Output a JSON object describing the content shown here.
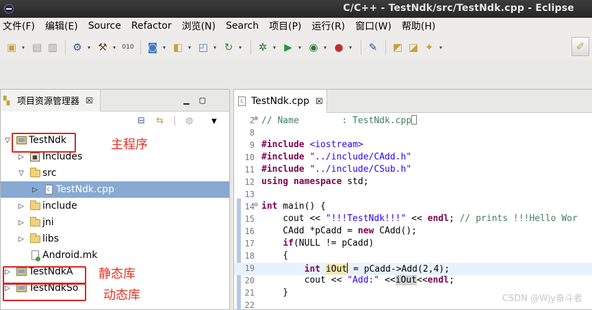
{
  "window": {
    "title": "C/C++ - TestNdk/src/TestNdk.cpp - Eclipse"
  },
  "menu": [
    "文件(F)",
    "编辑(E)",
    "Source",
    "Refactor",
    "浏览(N)",
    "Search",
    "项目(P)",
    "运行(R)",
    "窗口(W)",
    "帮助(H)"
  ],
  "toolbar": {
    "icons": [
      "new-icon",
      "save-icon",
      "save-all-icon",
      "settings-icon",
      "build-icon",
      "binary-icon",
      "new-class-icon",
      "new-folder-icon",
      "new-file-icon",
      "refresh-icon",
      "debug-icon",
      "run-icon",
      "external-tools-icon",
      "profile-icon",
      "pin-icon",
      "open-type-icon",
      "open-element-icon",
      "search-icon",
      "perspective-icon"
    ]
  },
  "explorer": {
    "tab_label": "项目资源管理器",
    "close": "☒",
    "tree": [
      {
        "label": "TestNdk",
        "kind": "project",
        "depth": 0,
        "expanded": true
      },
      {
        "label": "Includes",
        "kind": "includes",
        "depth": 1,
        "expanded": false
      },
      {
        "label": "src",
        "kind": "folder",
        "depth": 1,
        "expanded": true
      },
      {
        "label": "TestNdk.cpp",
        "kind": "file",
        "depth": 2,
        "expanded": false,
        "selected": true
      },
      {
        "label": "include",
        "kind": "folder",
        "depth": 1,
        "expanded": false
      },
      {
        "label": "jni",
        "kind": "folder",
        "depth": 1,
        "expanded": false
      },
      {
        "label": "libs",
        "kind": "folder",
        "depth": 1,
        "expanded": false
      },
      {
        "label": "Android.mk",
        "kind": "makefile",
        "depth": 1,
        "expanded": false
      },
      {
        "label": "TestNdkA",
        "kind": "project",
        "depth": 0,
        "expanded": false
      },
      {
        "label": "TestNdkSo",
        "kind": "project",
        "depth": 0,
        "expanded": false
      }
    ]
  },
  "annotations": {
    "main": "主程序",
    "static_lib": "静态库",
    "dynamic_lib": "动态库"
  },
  "editor": {
    "tab_label": "TestNdk.cpp",
    "lines": [
      {
        "n": "2",
        "fold": "⊕"
      },
      {
        "n": "8"
      },
      {
        "n": "9"
      },
      {
        "n": "10"
      },
      {
        "n": "11"
      },
      {
        "n": "12"
      },
      {
        "n": "13"
      },
      {
        "n": "14",
        "fold": "⊖"
      },
      {
        "n": "15"
      },
      {
        "n": "16"
      },
      {
        "n": "17"
      },
      {
        "n": "18"
      },
      {
        "n": "19"
      },
      {
        "n": "20"
      },
      {
        "n": "21"
      },
      {
        "n": "22"
      }
    ],
    "code": {
      "l2": "// Name        : TestNdk.cpp",
      "l9_kw": "#include",
      "l9_str": "<iostream>",
      "l10_kw": "#include",
      "l10_str": "\"../include/CAdd.h\"",
      "l11_kw": "#include",
      "l11_str": "\"../include/CSub.h\"",
      "l12_kw": "using namespace",
      "l12_rest": " std;",
      "l14_kw": "int",
      "l14_rest": " main() {",
      "l15_a": "    cout << ",
      "l15_str": "\"!!!TestNdk!!!\"",
      "l15_b": " << ",
      "l15_endl": "endl",
      "l15_c": "; ",
      "l15_cmt": "// prints !!!Hello Wor",
      "l16_a": "    CAdd *pCadd = ",
      "l16_kw": "new",
      "l16_b": " CAdd();",
      "l17_a": "    ",
      "l17_kw": "if",
      "l17_b": "(NULL != pCadd)",
      "l18": "    {",
      "l19_a": "        ",
      "l19_kw": "int",
      "l19_sp": " ",
      "l19_var": "iOut",
      "l19_b": " = pCadd->Add(2,4);",
      "l20_a": "        cout << ",
      "l20_str": "\"Add:\"",
      "l20_b": " <<",
      "l20_var": "iOut",
      "l20_c": "<<",
      "l20_endl": "endl",
      "l20_d": ";",
      "l21": "    }"
    }
  },
  "watermark": "CSDN @Wjy奋斗者"
}
